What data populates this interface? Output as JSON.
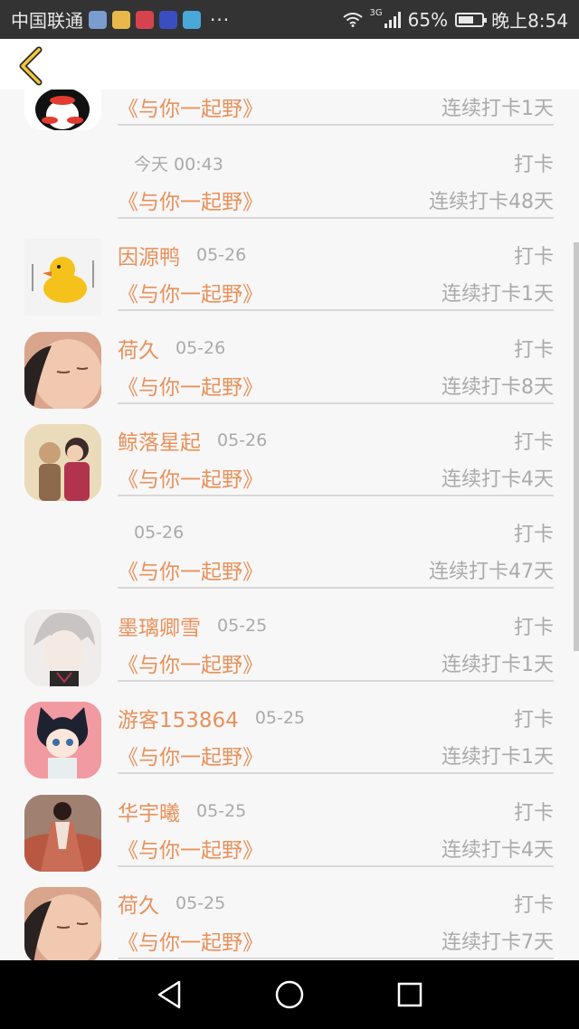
{
  "status_bar": {
    "carrier": "中国联通",
    "network": "3G",
    "battery": "65%",
    "time": "晚上8:54",
    "more": "···"
  },
  "header": {
    "back_icon": "chevron-left-icon"
  },
  "rows": [
    {
      "name": "",
      "date": "",
      "action": "",
      "book": "《与你一起野》",
      "streak": "连续打卡1天",
      "avatar": "penguin"
    },
    {
      "name": "",
      "date": "今天 00:43",
      "action": "打卡",
      "book": "《与你一起野》",
      "streak": "连续打卡48天",
      "avatar": "none"
    },
    {
      "name": "因源鸭",
      "date": "05-26",
      "action": "打卡",
      "book": "《与你一起野》",
      "streak": "连续打卡1天",
      "avatar": "duck"
    },
    {
      "name": "荷久",
      "date": "05-26",
      "action": "打卡",
      "book": "《与你一起野》",
      "streak": "连续打卡8天",
      "avatar": "baby"
    },
    {
      "name": "鲸落星起",
      "date": "05-26",
      "action": "打卡",
      "book": "《与你一起野》",
      "streak": "连续打卡4天",
      "avatar": "couple"
    },
    {
      "name": "",
      "date": "05-26",
      "action": "打卡",
      "book": "《与你一起野》",
      "streak": "连续打卡47天",
      "avatar": "none"
    },
    {
      "name": "墨璃卿雪",
      "date": "05-25",
      "action": "打卡",
      "book": "《与你一起野》",
      "streak": "连续打卡1天",
      "avatar": "anime-boy"
    },
    {
      "name": "游客153864",
      "date": "05-25",
      "action": "打卡",
      "book": "《与你一起野》",
      "streak": "连续打卡1天",
      "avatar": "cat-boy"
    },
    {
      "name": "华宇曦",
      "date": "05-25",
      "action": "打卡",
      "book": "《与你一起野》",
      "streak": "连续打卡4天",
      "avatar": "hanfu"
    },
    {
      "name": "荷久",
      "date": "05-25",
      "action": "打卡",
      "book": "《与你一起野》",
      "streak": "连续打卡7天",
      "avatar": "baby"
    }
  ],
  "colors": {
    "accent": "#e7915a",
    "muted": "#aaaaaa",
    "background": "#f8f7f8"
  }
}
